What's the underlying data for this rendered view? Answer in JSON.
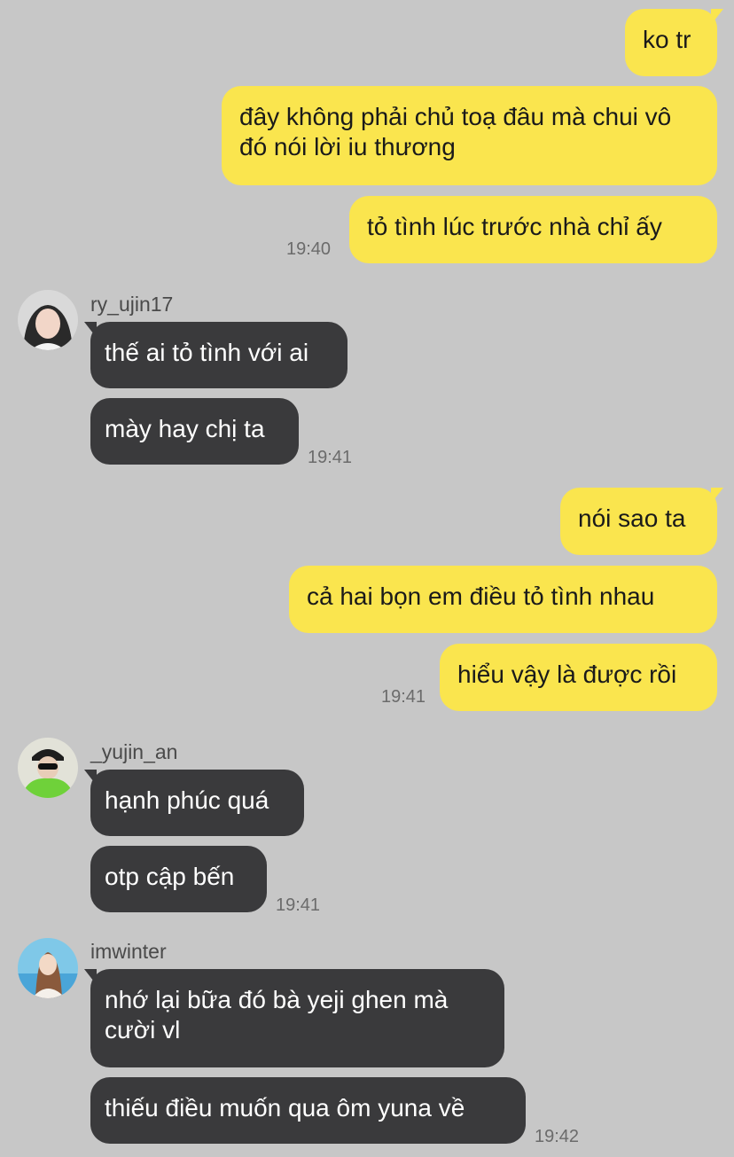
{
  "colors": {
    "background": "#c7c7c7",
    "outgoing_bubble": "#fae54e",
    "incoming_bubble": "#3a3a3c",
    "timestamp": "#6b6b6b"
  },
  "messages": {
    "m1": "ko tr",
    "m2": "đây không phải chủ toạ đâu mà chui vô đó nói lời iu thương",
    "m3": "tỏ tình lúc trước nhà chỉ ấy",
    "t1": "19:40",
    "s1": "ry_ujin17",
    "m4": "thế ai tỏ tình với ai",
    "m5": "mày hay chị ta",
    "t2": "19:41",
    "m6": "nói sao ta",
    "m7": "cả hai bọn em điều tỏ tình nhau",
    "m8": "hiểu vậy là được rồi",
    "t3": "19:41",
    "s2": "_yujin_an",
    "m9": "hạnh phúc quá",
    "m10": "otp cập bến",
    "t4": "19:41",
    "s3": "imwinter",
    "m11": "nhớ lại bữa đó bà yeji ghen mà cười vl",
    "m12": "thiếu điều muốn qua ôm yuna về",
    "t5": "19:42"
  }
}
